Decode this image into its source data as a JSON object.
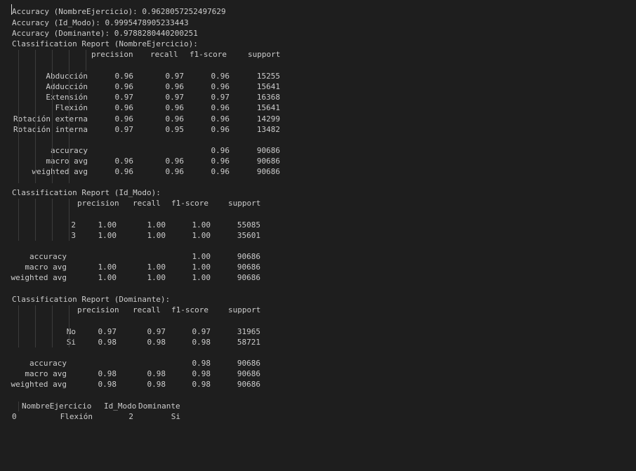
{
  "colors": {
    "background": "#1e1e1e",
    "text": "#cccccc",
    "guide": "#3c3c3c"
  },
  "summary": {
    "acc_nombre": "Accuracy (NombreEjercicio): 0.9628057252497629",
    "acc_modo": "Accuracy (Id_Modo): 0.9995478905233443",
    "acc_dominante": "Accuracy (Dominante): 0.9788280440200251"
  },
  "reports": [
    {
      "title": "Classification Report (NombreEjercicio):",
      "headers": [
        "precision",
        "recall",
        "f1-score",
        "support"
      ],
      "rows": [
        [
          "Abducción",
          "0.96",
          "0.97",
          "0.96",
          "15255"
        ],
        [
          "Adducción",
          "0.96",
          "0.96",
          "0.96",
          "15641"
        ],
        [
          "Extensión",
          "0.97",
          "0.97",
          "0.97",
          "16368"
        ],
        [
          "Flexión",
          "0.96",
          "0.96",
          "0.96",
          "15641"
        ],
        [
          "Rotación externa",
          "0.96",
          "0.96",
          "0.96",
          "14299"
        ],
        [
          "Rotación interna",
          "0.97",
          "0.95",
          "0.96",
          "13482"
        ]
      ],
      "totals": [
        [
          "accuracy",
          "",
          "",
          "0.96",
          "90686"
        ],
        [
          "macro avg",
          "0.96",
          "0.96",
          "0.96",
          "90686"
        ],
        [
          "weighted avg",
          "0.96",
          "0.96",
          "0.96",
          "90686"
        ]
      ]
    },
    {
      "title": "Classification Report (Id_Modo):",
      "headers": [
        "precision",
        "recall",
        "f1-score",
        "support"
      ],
      "rows": [
        [
          "2",
          "1.00",
          "1.00",
          "1.00",
          "55085"
        ],
        [
          "3",
          "1.00",
          "1.00",
          "1.00",
          "35601"
        ]
      ],
      "totals": [
        [
          "accuracy",
          "",
          "",
          "1.00",
          "90686"
        ],
        [
          "macro avg",
          "1.00",
          "1.00",
          "1.00",
          "90686"
        ],
        [
          "weighted avg",
          "1.00",
          "1.00",
          "1.00",
          "90686"
        ]
      ]
    },
    {
      "title": "Classification Report (Dominante):",
      "headers": [
        "precision",
        "recall",
        "f1-score",
        "support"
      ],
      "rows": [
        [
          "No",
          "0.97",
          "0.97",
          "0.97",
          "31965"
        ],
        [
          "Si",
          "0.98",
          "0.98",
          "0.98",
          "58721"
        ]
      ],
      "totals": [
        [
          "accuracy",
          "",
          "",
          "0.98",
          "90686"
        ],
        [
          "macro avg",
          "0.98",
          "0.98",
          "0.98",
          "90686"
        ],
        [
          "weighted avg",
          "0.98",
          "0.98",
          "0.98",
          "90686"
        ]
      ]
    }
  ],
  "dataframe": {
    "columns": [
      "NombreEjercicio",
      "Id_Modo",
      "Dominante"
    ],
    "row": {
      "index": "0",
      "values": [
        "Flexión",
        "2",
        "Si"
      ]
    }
  }
}
